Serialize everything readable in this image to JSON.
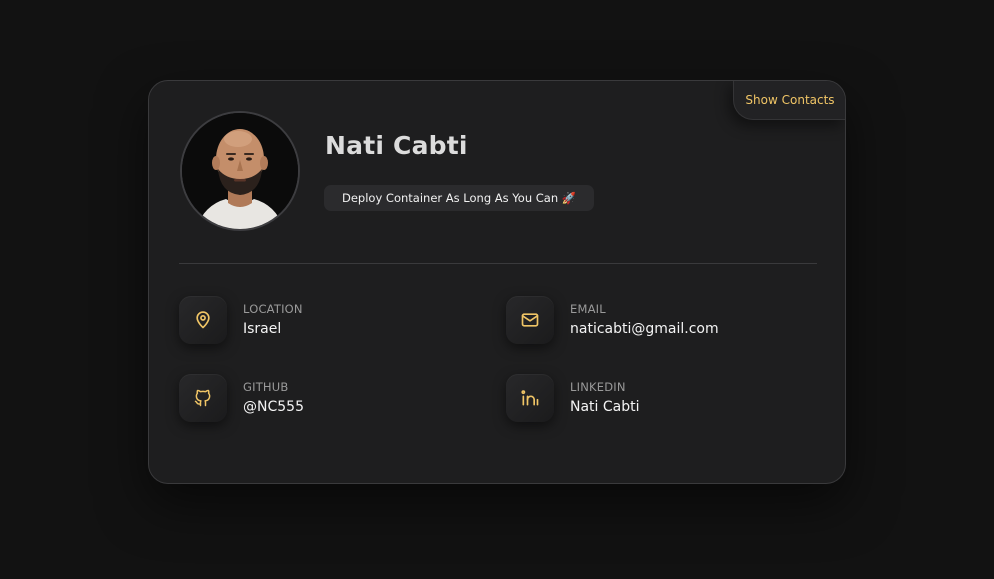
{
  "header": {
    "show_contacts_label": "Show Contacts"
  },
  "profile": {
    "name": "Nati Cabti",
    "tagline": "Deploy Container As Long As You Can 🚀",
    "avatar_alt": "Nati Cabti"
  },
  "contacts": [
    {
      "icon": "map-pin-icon",
      "label": "LOCATION",
      "value": "Israel"
    },
    {
      "icon": "mail-icon",
      "label": "EMAIL",
      "value": "naticabti@gmail.com"
    },
    {
      "icon": "github-icon",
      "label": "GITHUB",
      "value": "@NC555"
    },
    {
      "icon": "linkedin-icon",
      "label": "LINKEDIN",
      "value": "Nati Cabti"
    }
  ],
  "colors": {
    "background": "#121212",
    "card": "#1e1e1f",
    "accent": "#f0c566",
    "text_primary": "#f4f4f4",
    "text_secondary": "#9a9a9a"
  }
}
